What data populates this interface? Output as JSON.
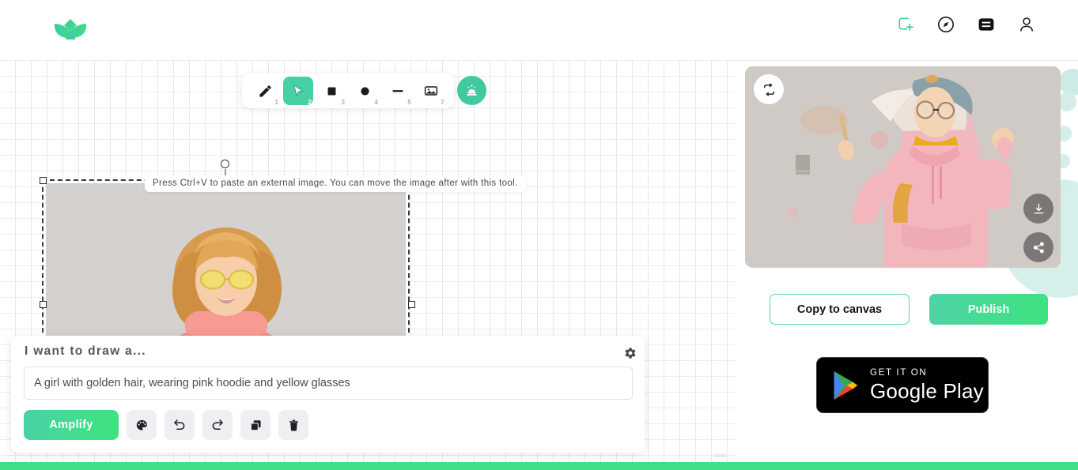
{
  "header": {
    "logo_name": "lotus-logo",
    "icons": [
      {
        "name": "add-square-icon",
        "label": "Add"
      },
      {
        "name": "compass-icon",
        "label": "Explore"
      },
      {
        "name": "menu-list-icon",
        "label": "Feed"
      },
      {
        "name": "user-account-icon",
        "label": "Account"
      }
    ]
  },
  "canvas": {
    "tooltip": "Press Ctrl+V to paste an external image. You can move the image after with this tool.",
    "toolbar": {
      "tools": [
        {
          "name": "pencil-tool",
          "icon": "pencil-icon",
          "num": "1",
          "active": false
        },
        {
          "name": "select-tool",
          "icon": "cursor-icon",
          "num": "2",
          "active": true
        },
        {
          "name": "rectangle-tool",
          "icon": "square-icon",
          "num": "3",
          "active": false
        },
        {
          "name": "ellipse-tool",
          "icon": "circle-icon",
          "num": "4",
          "active": false
        },
        {
          "name": "line-tool",
          "icon": "line-icon",
          "num": "5",
          "active": false
        },
        {
          "name": "image-tool",
          "icon": "image-icon",
          "num": "7",
          "active": false
        }
      ],
      "magic_button": "alarm-magic-icon"
    }
  },
  "prompt": {
    "title": "I want to draw a...",
    "input_value": "A girl with golden hair, wearing pink hoodie and yellow glasses",
    "input_placeholder": "A girl with golden hair, wearing pink hoodie and yellow glasses",
    "amplify_label": "Amplify",
    "settings_icon": "gear-icon",
    "actions": [
      {
        "name": "palette-button",
        "icon": "palette-icon"
      },
      {
        "name": "undo-button",
        "icon": "undo-icon"
      },
      {
        "name": "redo-button",
        "icon": "redo-icon"
      },
      {
        "name": "duplicate-button",
        "icon": "copy-icon"
      },
      {
        "name": "delete-button",
        "icon": "trash-icon"
      }
    ]
  },
  "result_panel": {
    "refresh_icon": "refresh-loop-icon",
    "download_icon": "download-icon",
    "share_icon": "share-icon",
    "copy_to_canvas_label": "Copy to canvas",
    "publish_label": "Publish",
    "google_play": {
      "small_text": "GET IT ON",
      "big_text": "Google Play"
    }
  },
  "colors": {
    "accent_green": "#42c9a0",
    "bright_green": "#3fdf87",
    "toolbar_active": "#46cfa4",
    "deco_teal": "#d5eeea"
  }
}
